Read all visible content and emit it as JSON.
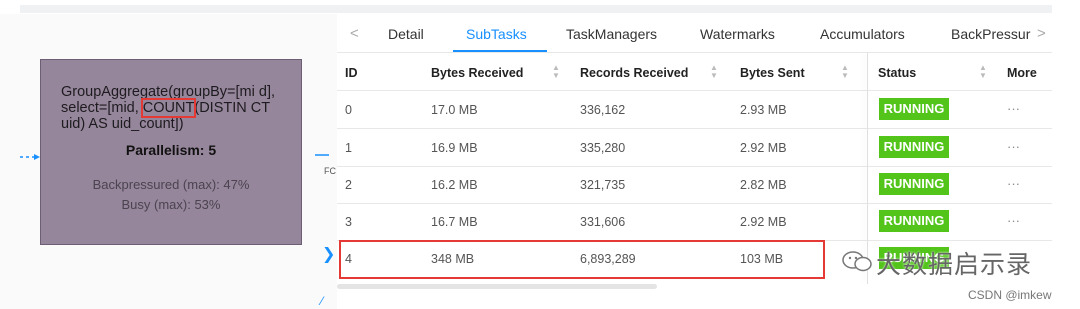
{
  "graph": {
    "node_title_parts": [
      "GroupAggregate(groupBy=[mi d], select=[mid, ",
      "COUNT",
      "(DISTIN CT uid) AS uid_count])"
    ],
    "parallelism": "Parallelism: 5",
    "backpressured": "Backpressured (max): 47%",
    "busy": "Busy (max): 53%",
    "edge_label": "FC"
  },
  "tabs": {
    "prev_arrow": "<",
    "next_arrow": ">",
    "items": [
      {
        "label": "Detail",
        "active": false
      },
      {
        "label": "SubTasks",
        "active": true
      },
      {
        "label": "TaskManagers",
        "active": false
      },
      {
        "label": "Watermarks",
        "active": false
      },
      {
        "label": "Accumulators",
        "active": false
      },
      {
        "label": "BackPressur",
        "active": false
      }
    ]
  },
  "table": {
    "columns": [
      "ID",
      "Bytes Received",
      "Records Received",
      "Bytes Sent",
      "Status",
      "More"
    ],
    "rows": [
      {
        "id": "0",
        "bytes_received": "17.0 MB",
        "records_received": "336,162",
        "bytes_sent": "2.93 MB",
        "status": "RUNNING",
        "more": "···"
      },
      {
        "id": "1",
        "bytes_received": "16.9 MB",
        "records_received": "335,280",
        "bytes_sent": "2.92 MB",
        "status": "RUNNING",
        "more": "···"
      },
      {
        "id": "2",
        "bytes_received": "16.2 MB",
        "records_received": "321,735",
        "bytes_sent": "2.82 MB",
        "status": "RUNNING",
        "more": "···"
      },
      {
        "id": "3",
        "bytes_received": "16.7 MB",
        "records_received": "331,606",
        "bytes_sent": "2.92 MB",
        "status": "RUNNING",
        "more": "···"
      },
      {
        "id": "4",
        "bytes_received": "348 MB",
        "records_received": "6,893,289",
        "bytes_sent": "103 MB",
        "status": "RUNNING",
        "more": ""
      }
    ]
  },
  "watermark": {
    "text": "大数据启示录",
    "credit": "CSDN @imkew"
  },
  "colors": {
    "accent": "#1890ff",
    "running": "#52c41a",
    "node": "#96869b",
    "highlight": "#e53935"
  }
}
